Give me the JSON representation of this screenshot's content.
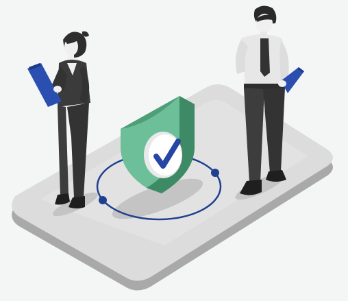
{
  "scene": {
    "subject": "verified-security-shield-illustration",
    "icons": [
      "shield-check-icon",
      "clipboard-icon"
    ],
    "colors": {
      "background": "#f3f6f5",
      "platform_top": "#dcdcdc",
      "platform_side": "#a9a9a9",
      "shield": "#6cbf99",
      "shield_dark": "#4e9e78",
      "check": "#2547a3",
      "orbit": "#1f3f8f",
      "clipboard": "#2a4fb0",
      "suit": "#3b3b3b",
      "shirt": "#e7e7e7"
    }
  }
}
